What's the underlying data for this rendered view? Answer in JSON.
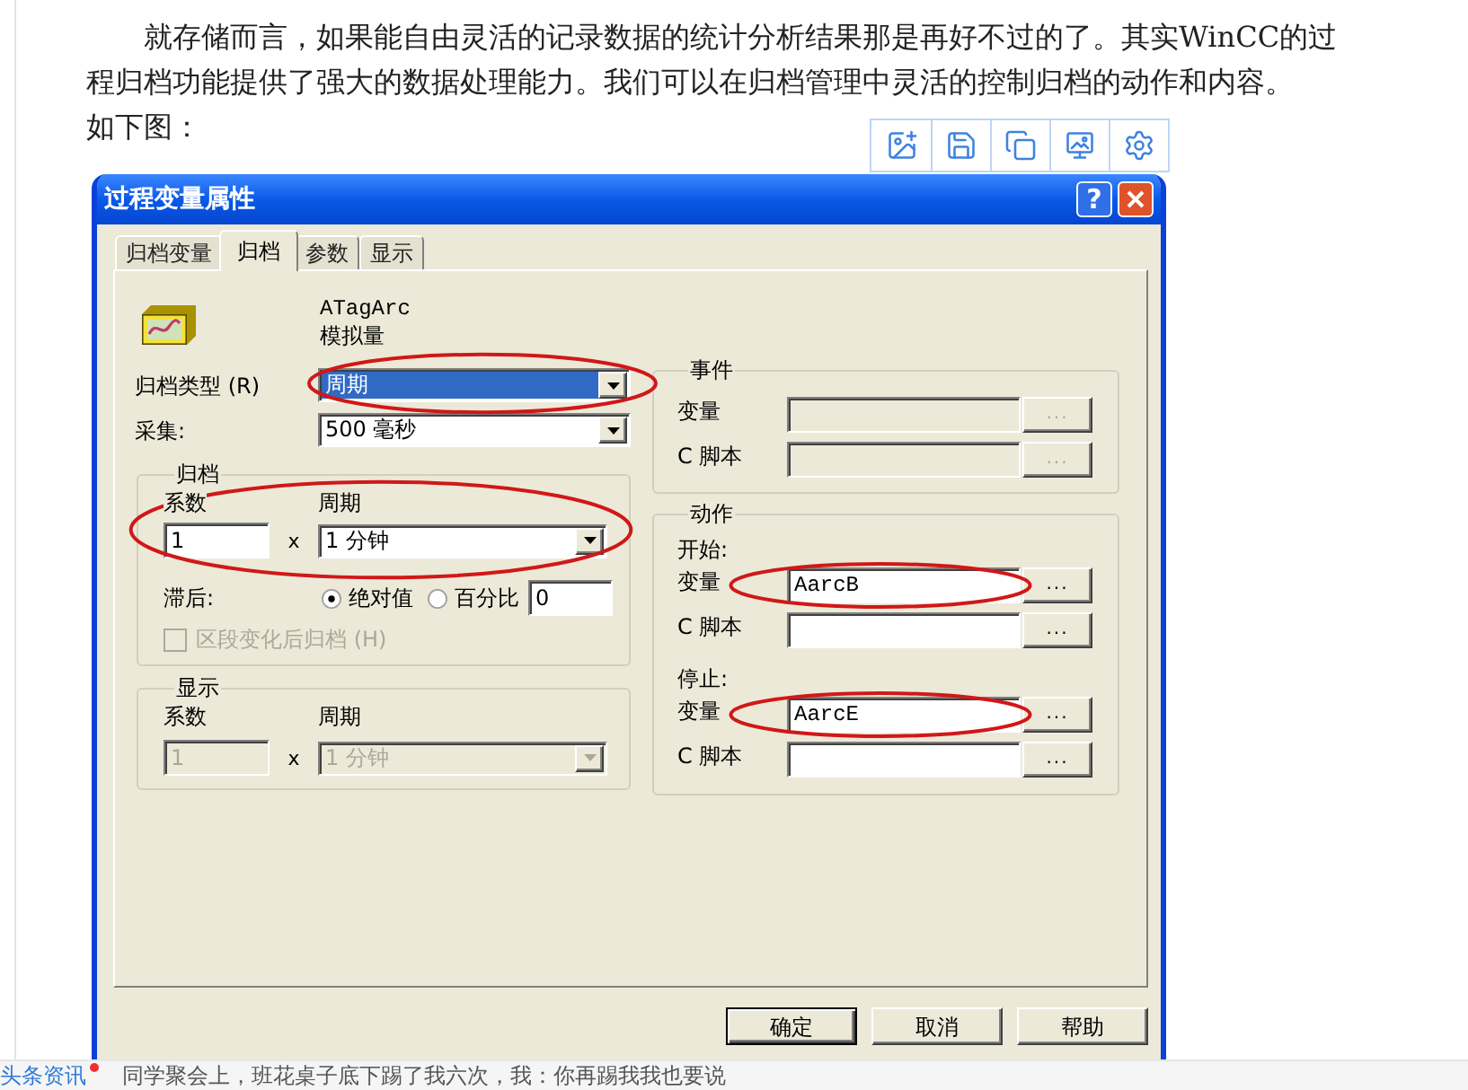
{
  "article": {
    "paragraph": "就存储而言，如果能自由灵活的记录数据的统计分析结果那是再好不过的了。其实WinCC的过程归档功能提供了强大的数据处理能力。我们可以在归档管理中灵活的控制归档的动作和内容。",
    "caption": "如下图："
  },
  "dialog": {
    "title": "过程变量属性",
    "help_button": "?",
    "tabs": [
      {
        "label": "归档变量",
        "selected": false
      },
      {
        "label": "归档",
        "selected": true
      },
      {
        "label": "参数",
        "selected": false
      },
      {
        "label": "显示",
        "selected": false
      }
    ],
    "tag": {
      "name": "ATagArc",
      "type": "模拟量"
    },
    "archive_type": {
      "label": "归档类型 (R)",
      "value": "周期",
      "focused": true,
      "highlighted": true
    },
    "acquisition": {
      "label": "采集:",
      "value": "500 毫秒"
    },
    "archive_group": {
      "title": "归档",
      "factor_label": "系数",
      "period_label": "周期",
      "factor": "1",
      "times": "x",
      "period": "1 分钟",
      "highlighted": true,
      "lag_label": "滞后:",
      "lag_options": [
        {
          "label": "绝对值",
          "selected": true
        },
        {
          "label": "百分比",
          "selected": false
        }
      ],
      "lag_value": "0",
      "segment_option": {
        "label": "区段变化后归档 (H)",
        "checked": false,
        "disabled": true
      }
    },
    "display_group": {
      "title": "显示",
      "factor_label": "系数",
      "period_label": "周期",
      "factor": "1",
      "times": "x",
      "period": "1 分钟",
      "disabled": true
    },
    "event_group": {
      "title": "事件",
      "rows": [
        {
          "label": "变量",
          "button": "...",
          "disabled": true,
          "highlighted": false
        },
        {
          "label": "C 脚本",
          "button": "...",
          "disabled": true,
          "highlighted": false
        }
      ]
    },
    "action_group": {
      "title": "动作",
      "sections": [
        {
          "title": "开始:",
          "rows": [
            {
              "label": "变量",
              "value": "AarcB",
              "button": "...",
              "disabled": false,
              "highlighted": true
            },
            {
              "label": "C 脚本",
              "button": "...",
              "disabled": false,
              "highlighted": false
            }
          ]
        },
        {
          "title": "停止:",
          "rows": [
            {
              "label": "变量",
              "value": "AarcE",
              "button": "...",
              "disabled": false,
              "highlighted": true
            },
            {
              "label": "C 脚本",
              "button": "...",
              "disabled": false,
              "highlighted": false
            }
          ]
        }
      ]
    },
    "buttons": [
      {
        "label": "确定",
        "default": true
      },
      {
        "label": "取消",
        "default": false
      },
      {
        "label": "帮助",
        "default": false
      }
    ]
  },
  "footer": {
    "source": "头条资讯",
    "unread": true,
    "headline": "同学聚会上，班花桌子底下踢了我六次，我：你再踢我我也要说"
  }
}
